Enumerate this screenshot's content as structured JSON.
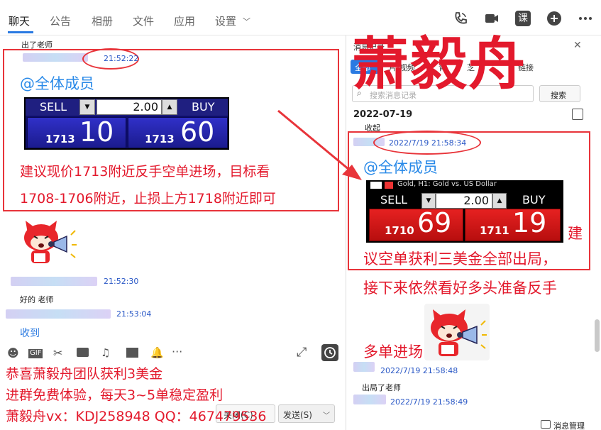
{
  "nav": {
    "tabs": [
      "聊天",
      "公告",
      "相册",
      "文件",
      "应用",
      "设置"
    ],
    "settings_caret": "﹀",
    "ke_label": "课"
  },
  "chat": {
    "msg0_text": "出了老师",
    "msg1_time": "21:52:22",
    "msg1_at": "@全体成员",
    "panel1": {
      "sell": "SELL",
      "buy": "BUY",
      "qty": "2.00",
      "sell_small": "1713",
      "sell_big": "10",
      "buy_small": "1713",
      "buy_big": "60"
    },
    "msg1_line1": "建议现价1713附近反手空单进场，目标看",
    "msg1_line2": "1708-1706附近，止损上方1718附近即可",
    "msg2_time": "21:52:30",
    "msg3_text": "好的 老师",
    "msg3_time": "21:53:04",
    "msg4_text": "收到"
  },
  "bottom": {
    "promo1": "恭喜萧毅舟团队获利3美金",
    "promo2": "进群免费体验，每天3~5单稳定盈利",
    "promo3": "萧毅舟vx：KDJ258948  QQ：467479536",
    "close_button": "关闭(C)",
    "send_button": "发送(S)"
  },
  "right": {
    "header": "消息记录",
    "filters": [
      "全部",
      "图片/视频",
      "文件",
      "链接"
    ],
    "filters_partial": [
      "全部",
      "片/视频",
      "青",
      "芝",
      "链接"
    ],
    "search_placeholder": "搜索消息记录",
    "search_button": "搜索",
    "date": "2022-07-19",
    "collapsed_label": "收起",
    "msg1_time": "2022/7/19 21:58:34",
    "msg1_at": "@全体成员",
    "panel2": {
      "title": "Gold, H1:  Gold vs. US Dollar",
      "sell": "SELL",
      "buy": "BUY",
      "qty": "2.00",
      "sell_small": "1710",
      "sell_big": "69",
      "buy_small": "1711",
      "buy_big": "19"
    },
    "msg1_l1": "建",
    "msg1_l2": "议空单获利三美金全部出局，",
    "msg1_l3": "接下来依然看好多头准备反手",
    "msg1_l4": "多单进场",
    "msg2_time": "2022/7/19 21:58:48",
    "msg2_text": "出局了老师",
    "msg3_time": "2022/7/19 21:58:49",
    "manage": "消息管理"
  },
  "watermark": "萧毅舟",
  "colors": {
    "accent": "#2a7ae2",
    "annotation_red": "#e3192c",
    "timestamp_blue": "#2a58c6"
  }
}
